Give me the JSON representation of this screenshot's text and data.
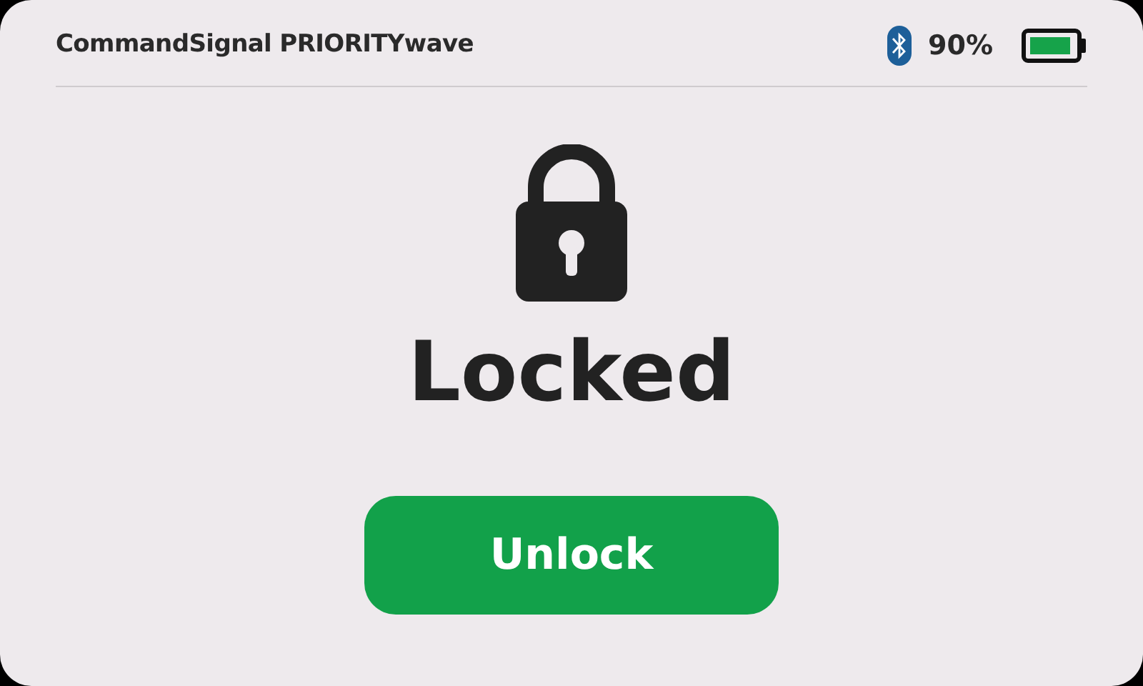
{
  "header": {
    "title": "CommandSignal PRIORITYwave",
    "battery_reading": "90%"
  },
  "status": "Locked",
  "unlock_button": "Unlock"
}
